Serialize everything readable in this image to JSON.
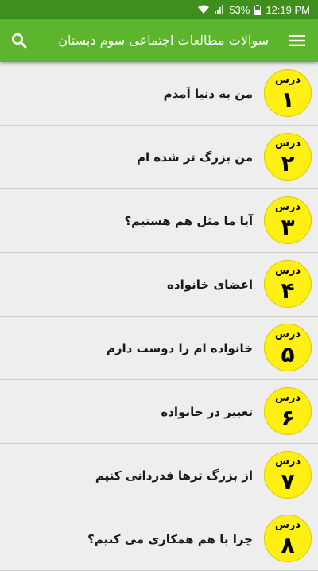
{
  "status_bar": {
    "battery": "53%",
    "time": "12:19 PM"
  },
  "app_bar": {
    "title": "سوالات مطالعات اجتماعی سوم دبستان",
    "menu_icon": "hamburger-menu-icon",
    "search_icon": "search-icon"
  },
  "lessons": [
    {
      "word": "درس",
      "number": "۱",
      "title": "من به دنیا آمدم"
    },
    {
      "word": "درس",
      "number": "۲",
      "title": "من بزرگ تر شده ام"
    },
    {
      "word": "درس",
      "number": "۳",
      "title": "آیا ما مثل هم هستیم؟"
    },
    {
      "word": "درس",
      "number": "۴",
      "title": "اعضای خانواده"
    },
    {
      "word": "درس",
      "number": "۵",
      "title": "خانواده ام را دوست دارم"
    },
    {
      "word": "درس",
      "number": "۶",
      "title": "تغییر در خانواده"
    },
    {
      "word": "درس",
      "number": "۷",
      "title": "از بزرگ ترها قدردانی کنیم"
    },
    {
      "word": "درس",
      "number": "۸",
      "title": "چرا با هم همکاری می کنیم؟"
    }
  ],
  "colors": {
    "status_bar": "#3e8f1e",
    "app_bar": "#5cb52c",
    "badge": "#ffef12",
    "background": "#eeeeee"
  }
}
